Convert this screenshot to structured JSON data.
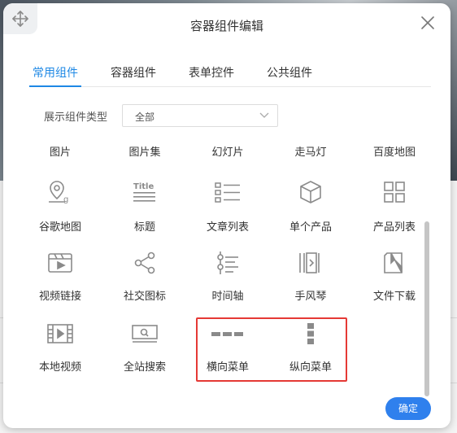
{
  "dialog": {
    "title": "容器组件编辑",
    "confirm_label": "确定"
  },
  "tabs": [
    {
      "label": "常用组件",
      "active": true
    },
    {
      "label": "容器组件",
      "active": false
    },
    {
      "label": "表单控件",
      "active": false
    },
    {
      "label": "公共组件",
      "active": false
    }
  ],
  "filter": {
    "label": "展示组件类型",
    "selected": "全部"
  },
  "components": {
    "row1": [
      {
        "label": "图片"
      },
      {
        "label": "图片集"
      },
      {
        "label": "幻灯片"
      },
      {
        "label": "走马灯"
      },
      {
        "label": "百度地图"
      }
    ],
    "row2": [
      {
        "label": "谷歌地图",
        "icon": "map-pin-icon"
      },
      {
        "label": "标题",
        "icon": "title-icon",
        "icon_text": "Title"
      },
      {
        "label": "文章列表",
        "icon": "article-list-icon"
      },
      {
        "label": "单个产品",
        "icon": "product-box-icon"
      },
      {
        "label": "产品列表",
        "icon": "product-grid-icon"
      }
    ],
    "row3": [
      {
        "label": "视频链接",
        "icon": "video-link-icon"
      },
      {
        "label": "社交图标",
        "icon": "share-icon"
      },
      {
        "label": "时间轴",
        "icon": "timeline-icon"
      },
      {
        "label": "手风琴",
        "icon": "accordion-icon"
      },
      {
        "label": "文件下载",
        "icon": "file-download-icon"
      }
    ],
    "row4": [
      {
        "label": "本地视频",
        "icon": "local-video-icon"
      },
      {
        "label": "全站搜索",
        "icon": "site-search-icon"
      },
      {
        "label": "横向菜单",
        "icon": "horizontal-menu-icon"
      },
      {
        "label": "纵向菜单",
        "icon": "vertical-menu-icon"
      }
    ]
  },
  "colors": {
    "accent": "#1e88e5",
    "highlight_border": "#e53935",
    "icon_gray": "#8a8a8a"
  }
}
